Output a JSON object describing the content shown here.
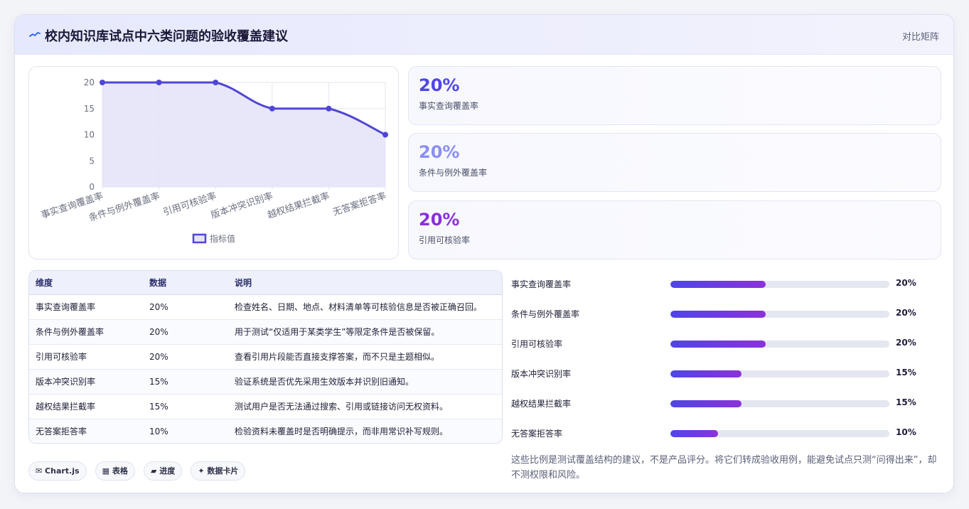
{
  "header": {
    "icon": "sparkline-icon",
    "title": "校内知识库试点中六类问题的验收覆盖建议",
    "right_link": "对比矩阵"
  },
  "chart_data": {
    "type": "line",
    "categories": [
      "事实查询覆盖率",
      "条件与例外覆盖率",
      "引用可核验率",
      "版本冲突识别率",
      "越权结果拦截率",
      "无答案拒答率"
    ],
    "series": [
      {
        "name": "指标值",
        "values": [
          20,
          20,
          20,
          15,
          15,
          10
        ]
      }
    ],
    "ylim": [
      0,
      20
    ],
    "yticks": [
      0,
      5,
      10,
      15,
      20
    ],
    "grid": true,
    "legend": "bottom",
    "colors": {
      "line": "#5046d6",
      "fill": "#e6e3f8"
    }
  },
  "stats": [
    {
      "value": "20%",
      "label": "事实查询覆盖率",
      "color": "#4f46e5"
    },
    {
      "value": "20%",
      "label": "条件与例外覆盖率",
      "color": "#8b8ef0"
    },
    {
      "value": "20%",
      "label": "引用可核验率",
      "color": "#8b2fd9"
    }
  ],
  "table": {
    "headers": [
      "维度",
      "数据",
      "说明"
    ],
    "rows": [
      [
        "事实查询覆盖率",
        "20%",
        "检查姓名、日期、地点、材料清单等可核验信息是否被正确召回。"
      ],
      [
        "条件与例外覆盖率",
        "20%",
        "用于测试“仅适用于某类学生”等限定条件是否被保留。"
      ],
      [
        "引用可核验率",
        "20%",
        "查看引用片段能否直接支撑答案，而不只是主题相似。"
      ],
      [
        "版本冲突识别率",
        "15%",
        "验证系统是否优先采用生效版本并识别旧通知。"
      ],
      [
        "越权结果拦截率",
        "15%",
        "测试用户是否无法通过搜索、引用或链接访问无权资料。"
      ],
      [
        "无答案拒答率",
        "10%",
        "检验资料未覆盖时是否明确提示，而非用常识补写规则。"
      ]
    ]
  },
  "progress": [
    {
      "label": "事实查询覆盖率",
      "value_text": "20%",
      "percent": 20
    },
    {
      "label": "条件与例外覆盖率",
      "value_text": "20%",
      "percent": 20
    },
    {
      "label": "引用可核验率",
      "value_text": "20%",
      "percent": 20
    },
    {
      "label": "版本冲突识别率",
      "value_text": "15%",
      "percent": 15
    },
    {
      "label": "越权结果拦截率",
      "value_text": "15%",
      "percent": 15
    },
    {
      "label": "无答案拒答率",
      "value_text": "10%",
      "percent": 10
    }
  ],
  "progress_scale_max": 46,
  "note": "这些比例是测试覆盖结构的建议，不是产品评分。将它们转成验收用例，能避免试点只测“问得出来”，却不测权限和风险。",
  "chips": [
    {
      "icon": "chart-icon",
      "label": "✉ Chart.js"
    },
    {
      "icon": "table-icon",
      "label": "▦ 表格"
    },
    {
      "icon": "progress-icon",
      "label": "▰ 进度"
    },
    {
      "icon": "card-icon",
      "label": "✦ 数据卡片"
    }
  ]
}
